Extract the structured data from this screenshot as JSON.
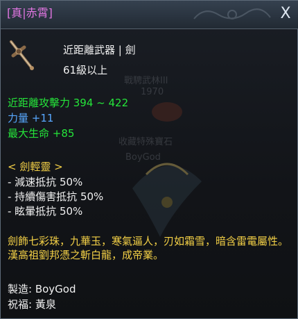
{
  "title": "[真|赤霄]",
  "close_label": "X",
  "item_type": "近距離武器 | 劍",
  "level_requirement": "61級以上",
  "stats": {
    "attack": "近距離攻擊力 394 ~ 422",
    "strength": "力量 +11",
    "max_hp": "最大生命 +85"
  },
  "spirit": {
    "header": "< 劍輕靈 >",
    "lines": [
      "- 減速抵抗 50%",
      "- 持續傷害抵抗 50%",
      "- 眩暈抵抗 50%"
    ]
  },
  "description": "劍飾七彩珠，九華玉，寒氣逼人，刃如霜雪，暗含雷電屬性。漢高祖劉邦憑之斬白龍，成帝業。",
  "crafted_by": "製造: BoyGod",
  "blessing": "祝福: 黃泉",
  "watermark": {
    "line1": "戰騁武林III",
    "line2": "1970",
    "line3": "收藏特殊寶石",
    "line4": "BoyGod"
  },
  "colors": {
    "title": "#e276e2",
    "attack_stat": "#25e53a",
    "strength_stat": "#58a8ff",
    "hp_stat": "#25e53a",
    "spirit_text": "#f2cf46",
    "body_text": "#f1f1f1"
  },
  "icons": {
    "item": "sword-icon",
    "close": "close-icon"
  }
}
